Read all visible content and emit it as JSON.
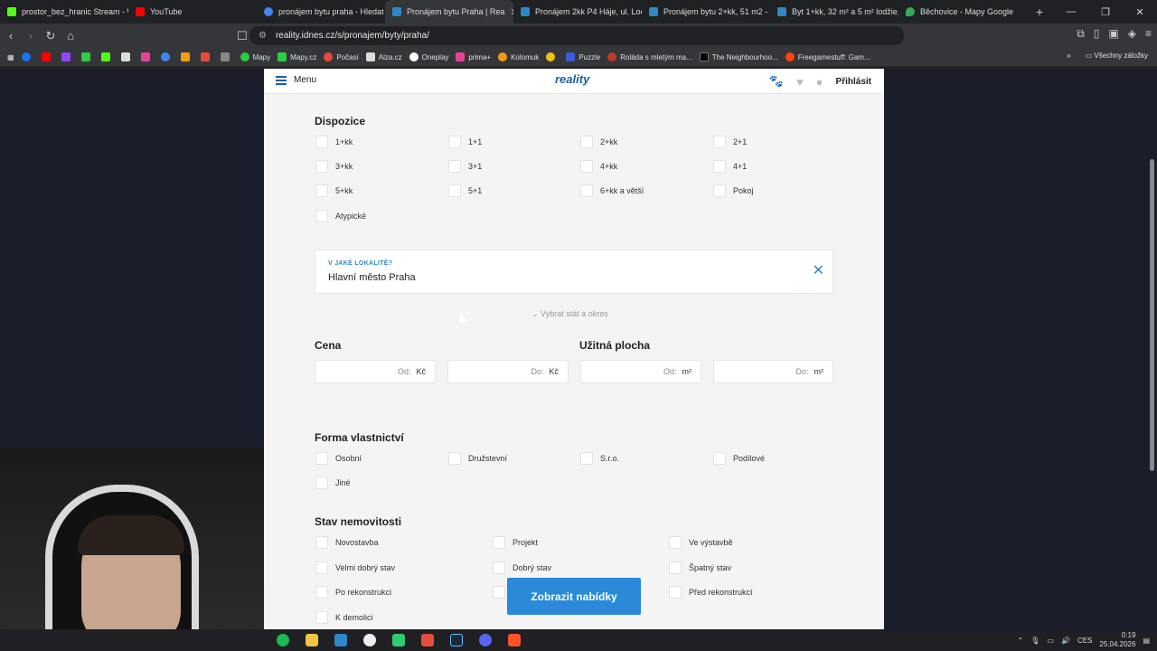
{
  "browser": {
    "tabs": [
      {
        "title": "prostor_bez_hranic Stream - W",
        "color": "#53fc18"
      },
      {
        "title": "YouTube",
        "color": "#ff0000"
      },
      {
        "title": "pronájem bytu praha - Hledat",
        "color": "#4285f4"
      },
      {
        "title": "Pronájem bytu Praha | Rea",
        "color": "#2d88c8",
        "active": true
      },
      {
        "title": "Pronájem 2kk P4 Háje, ul. Loos",
        "color": "#2d88c8"
      },
      {
        "title": "Pronájem bytu 2+kk, 51 m2 - P",
        "color": "#2d88c8"
      },
      {
        "title": "Byt 1+kk, 32 m² a 5 m² lodžie,",
        "color": "#2d88c8"
      },
      {
        "title": "Běchovice - Mapy Google",
        "color": "#34a853"
      }
    ],
    "url": "reality.idnes.cz/s/pronajem/byty/praha/",
    "bookmarks": [
      "Mapy",
      "Mapy.cz",
      "Počasí",
      "Alza.cz",
      "Oneplay",
      "prima+",
      "Kolomuk",
      "Puzzle",
      "Roláda s mletým ma...",
      "The Neighbourhoo...",
      "Freegamestuff: Gam..."
    ],
    "bookmarks_all": "Všechny záložky"
  },
  "header": {
    "menu": "Menu",
    "logo": "reality",
    "login": "Přihlásit"
  },
  "dispozice": {
    "title": "Dispozice",
    "options": [
      "1+kk",
      "1+1",
      "2+kk",
      "2+1",
      "3+kk",
      "3+1",
      "4+kk",
      "4+1",
      "5+kk",
      "5+1",
      "6+kk a větší",
      "Pokoj",
      "Atypické"
    ]
  },
  "location": {
    "label": "V JAKÉ LOKALITĚ?",
    "value": "Hlavní město Praha",
    "more": "Vybrat stát a okres"
  },
  "cena": {
    "title": "Cena",
    "from": "Od:",
    "to": "Do:",
    "unit": "Kč"
  },
  "plocha": {
    "title": "Užitná plocha",
    "from": "Od:",
    "to": "Do:",
    "unit": "m²"
  },
  "forma": {
    "title": "Forma vlastnictví",
    "options": [
      "Osobní",
      "Družstevní",
      "S.r.o.",
      "Podílové",
      "Jiné"
    ]
  },
  "stav": {
    "title": "Stav nemovitosti",
    "options": [
      "Novostavba",
      "Projekt",
      "Ve výstavbě",
      "Velmi dobrý stav",
      "Dobrý stav",
      "Špatný stav",
      "Po rekonstrukci",
      "",
      "Před rekonstrukcí",
      "K demolici"
    ]
  },
  "submit": "Zobrazit nabídky",
  "taskbar": {
    "lang": "CES",
    "time": "0:19",
    "date": "25.04.2026"
  }
}
